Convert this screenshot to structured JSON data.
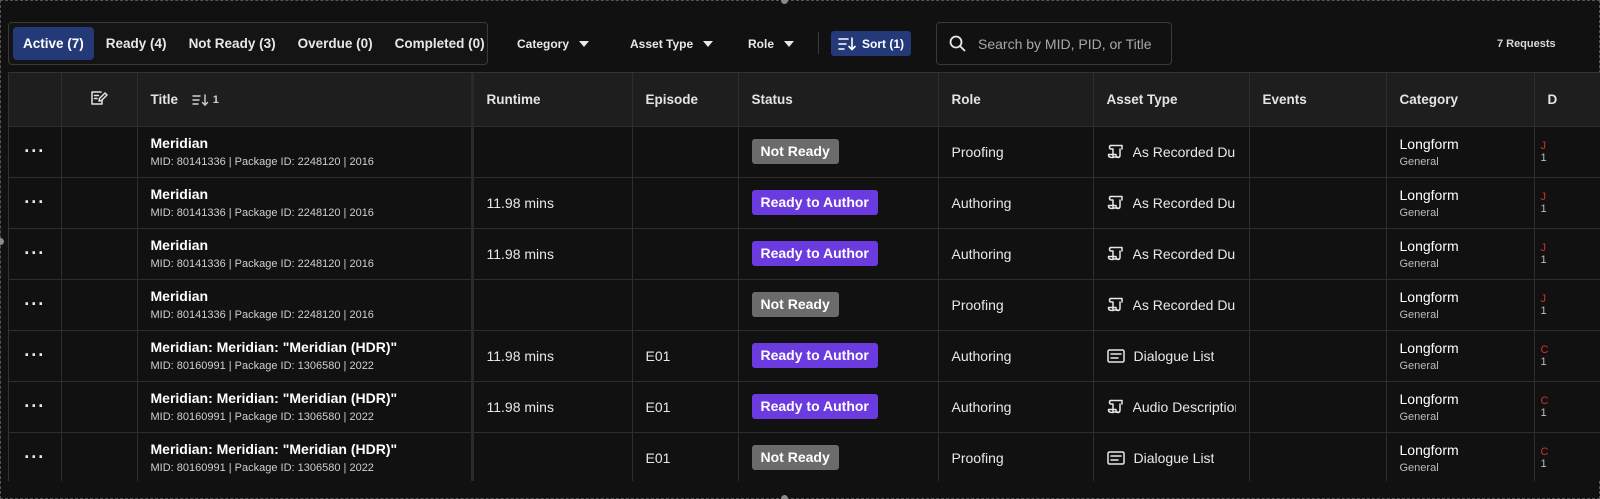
{
  "tabs": [
    {
      "label": "Active (7)",
      "active": true
    },
    {
      "label": "Ready (4)",
      "active": false
    },
    {
      "label": "Not Ready (3)",
      "active": false
    },
    {
      "label": "Overdue (0)",
      "active": false
    },
    {
      "label": "Completed (0)",
      "active": false
    }
  ],
  "filters": {
    "category": "Category",
    "asset_type": "Asset Type",
    "role": "Role"
  },
  "sort": {
    "label": "Sort (1)"
  },
  "search": {
    "placeholder": "Search by MID, PID, or Title",
    "value": ""
  },
  "request_count": {
    "value": "7",
    "label": "Requests"
  },
  "table": {
    "columns": {
      "title": "Title",
      "title_sort_order": "1",
      "runtime": "Runtime",
      "episode": "Episode",
      "status": "Status",
      "role": "Role",
      "asset_type": "Asset Type",
      "events": "Events",
      "category": "Category",
      "next_column": "D"
    },
    "rows": [
      {
        "title": "Meridian",
        "subtitle": "MID: 80141336 | Package ID: 2248120 | 2016",
        "runtime": "",
        "episode": "",
        "status": "Not Ready",
        "role": "Proofing",
        "asset_type": "As Recorded Dub",
        "asset_icon": "script-icon",
        "events": "",
        "category": "Longform",
        "category_sub": "General",
        "edge_top": "J",
        "edge_bottom": "1"
      },
      {
        "title": "Meridian",
        "subtitle": "MID: 80141336 | Package ID: 2248120 | 2016",
        "runtime": "11.98 mins",
        "episode": "",
        "status": "Ready to Author",
        "role": "Authoring",
        "asset_type": "As Recorded Dub",
        "asset_icon": "script-icon",
        "events": "",
        "category": "Longform",
        "category_sub": "General",
        "edge_top": "J",
        "edge_bottom": "1"
      },
      {
        "title": "Meridian",
        "subtitle": "MID: 80141336 | Package ID: 2248120 | 2016",
        "runtime": "11.98 mins",
        "episode": "",
        "status": "Ready to Author",
        "role": "Authoring",
        "asset_type": "As Recorded Dub",
        "asset_icon": "script-icon",
        "events": "",
        "category": "Longform",
        "category_sub": "General",
        "edge_top": "J",
        "edge_bottom": "1"
      },
      {
        "title": "Meridian",
        "subtitle": "MID: 80141336 | Package ID: 2248120 | 2016",
        "runtime": "",
        "episode": "",
        "status": "Not Ready",
        "role": "Proofing",
        "asset_type": "As Recorded Dub",
        "asset_icon": "script-icon",
        "events": "",
        "category": "Longform",
        "category_sub": "General",
        "edge_top": "J",
        "edge_bottom": "1"
      },
      {
        "title": "Meridian: Meridian: \"Meridian (HDR)\"",
        "subtitle": "MID: 80160991 | Package ID: 1306580 | 2022",
        "runtime": "11.98 mins",
        "episode": "E01",
        "status": "Ready to Author",
        "role": "Authoring",
        "asset_type": "Dialogue List",
        "asset_icon": "list-icon",
        "events": "",
        "category": "Longform",
        "category_sub": "General",
        "edge_top": "C",
        "edge_bottom": "1"
      },
      {
        "title": "Meridian: Meridian: \"Meridian (HDR)\"",
        "subtitle": "MID: 80160991 | Package ID: 1306580 | 2022",
        "runtime": "11.98 mins",
        "episode": "E01",
        "status": "Ready to Author",
        "role": "Authoring",
        "asset_type": "Audio Description",
        "asset_icon": "script-icon",
        "events": "",
        "category": "Longform",
        "category_sub": "General",
        "edge_top": "C",
        "edge_bottom": "1"
      },
      {
        "title": "Meridian: Meridian: \"Meridian (HDR)\"",
        "subtitle": "MID: 80160991 | Package ID: 1306580 | 2022",
        "runtime": "",
        "episode": "E01",
        "status": "Not Ready",
        "role": "Proofing",
        "asset_type": "Dialogue List",
        "asset_icon": "list-icon",
        "events": "",
        "category": "Longform",
        "category_sub": "General",
        "edge_top": "C",
        "edge_bottom": "1"
      }
    ]
  },
  "colors": {
    "accent": "#243978",
    "ready_badge": "#6b3be0",
    "not_ready_badge": "#6b6b6b",
    "background": "#111111"
  }
}
